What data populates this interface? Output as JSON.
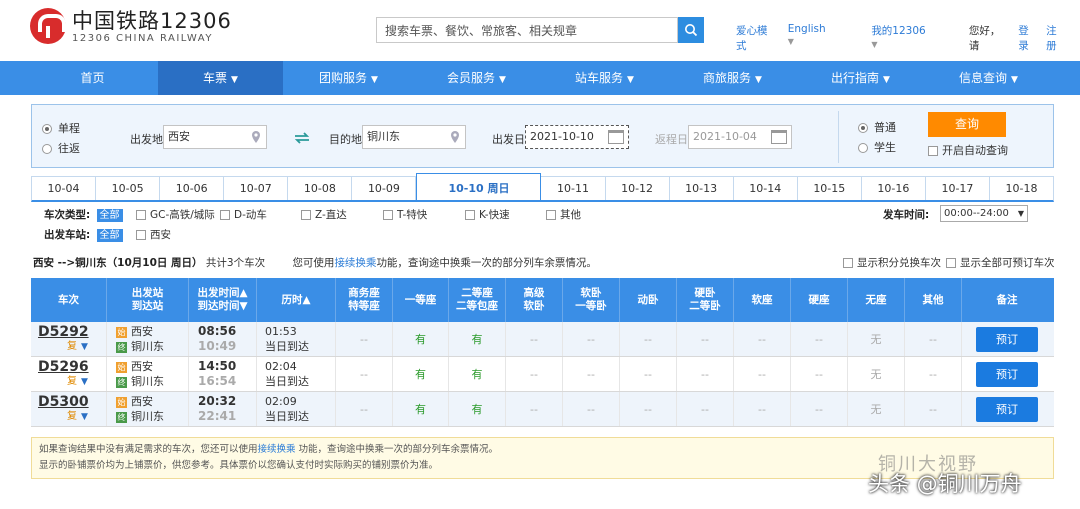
{
  "header": {
    "logo_cn": "中国铁路12306",
    "logo_en": "12306 CHINA RAILWAY",
    "search_placeholder": "搜索车票、餐饮、常旅客、相关规章",
    "links": {
      "care_mode": "爱心模式",
      "english": "English",
      "my12306": "我的12306",
      "greeting": "您好，请",
      "login": "登录",
      "register": "注册"
    }
  },
  "nav": [
    "首页",
    "车票",
    "团购服务",
    "会员服务",
    "站车服务",
    "商旅服务",
    "出行指南",
    "信息查询"
  ],
  "query": {
    "one_way": "单程",
    "round_trip": "往返",
    "from_label": "出发地",
    "from_value": "西安",
    "to_label": "目的地",
    "to_value": "铜川东",
    "depart_label": "出发日",
    "depart_value": "2021-10-10",
    "return_label": "返程日",
    "return_value": "2021-10-04",
    "normal": "普通",
    "student": "学生",
    "query_btn": "查询",
    "auto_query": "开启自动查询"
  },
  "dates": [
    "10-04",
    "10-05",
    "10-06",
    "10-07",
    "10-08",
    "10-09",
    "10-10 周日",
    "10-11",
    "10-12",
    "10-13",
    "10-14",
    "10-15",
    "10-16",
    "10-17",
    "10-18"
  ],
  "filters": {
    "type_label": "车次类型:",
    "all": "全部",
    "types": [
      "GC-高铁/城际",
      "D-动车",
      "Z-直达",
      "T-特快",
      "K-快速",
      "其他"
    ],
    "station_label": "出发车站:",
    "station": "西安",
    "time_label": "发车时间:",
    "time_value": "00:00--24:00"
  },
  "summary": {
    "route": "西安 -->铜川东（10月10日 周日）",
    "count": "共计3个车次",
    "tip_pre": "您可使用",
    "tip_link": "接续换乘",
    "tip_post": "功能，查询途中换乘一次的部分列车余票情况。",
    "show_points": "显示积分兑换车次",
    "show_all": "显示全部可预订车次"
  },
  "table": {
    "headers": [
      [
        "车次"
      ],
      [
        "出发站",
        "到达站"
      ],
      [
        "出发时间▲",
        "到达时间▼"
      ],
      [
        "历时▲"
      ],
      [
        "商务座",
        "特等座"
      ],
      [
        "一等座"
      ],
      [
        "二等座",
        "二等包座"
      ],
      [
        "高级",
        "软卧"
      ],
      [
        "软卧",
        "一等卧"
      ],
      [
        "动卧"
      ],
      [
        "硬卧",
        "二等卧"
      ],
      [
        "软座"
      ],
      [
        "硬座"
      ],
      [
        "无座"
      ],
      [
        "其他"
      ],
      [
        "备注"
      ]
    ],
    "rows": [
      {
        "no": "D5292",
        "fu": "复",
        "from": "西安",
        "to": "铜川东",
        "dep": "08:56",
        "arr": "10:49",
        "dur": "01:53",
        "arrive_note": "当日到达",
        "seats": [
          "--",
          "有",
          "有",
          "--",
          "--",
          "--",
          "--",
          "--",
          "--",
          "无",
          "--"
        ],
        "book": "预订"
      },
      {
        "no": "D5296",
        "fu": "复",
        "from": "西安",
        "to": "铜川东",
        "dep": "14:50",
        "arr": "16:54",
        "dur": "02:04",
        "arrive_note": "当日到达",
        "seats": [
          "--",
          "有",
          "有",
          "--",
          "--",
          "--",
          "--",
          "--",
          "--",
          "无",
          "--"
        ],
        "book": "预订"
      },
      {
        "no": "D5300",
        "fu": "复",
        "from": "西安",
        "to": "铜川东",
        "dep": "20:32",
        "arr": "22:41",
        "dur": "02:09",
        "arrive_note": "当日到达",
        "seats": [
          "--",
          "有",
          "有",
          "--",
          "--",
          "--",
          "--",
          "--",
          "--",
          "无",
          "--"
        ],
        "book": "预订"
      }
    ]
  },
  "note": {
    "line1_pre": "如果查询结果中没有满足需求的车次，您还可以使用",
    "line1_link": "接续换乘",
    "line1_post": " 功能，查询途中换乘一次的部分列车余票情况。",
    "line2": "显示的卧铺票价均为上铺票价，供您参考。具体票价以您确认支付时实际购买的铺别票价为准。"
  },
  "watermark": {
    "line1": "铜川大视野",
    "line2": "头条 @铜川万舟"
  },
  "colors": {
    "primary": "#3a8ee6",
    "orange": "#ff8a00",
    "book": "#1b7be0",
    "logo_red": "#d82c2c"
  }
}
